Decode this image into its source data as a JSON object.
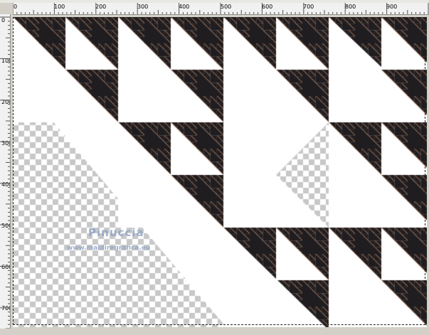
{
  "ruler": {
    "top_labels": [
      "0",
      "100",
      "200",
      "300",
      "400",
      "500",
      "600",
      "700",
      "800",
      "900"
    ],
    "left_labels": [
      "0",
      "100",
      "200",
      "300",
      "400",
      "500",
      "600",
      "700"
    ]
  },
  "watermark": {
    "name": "Pinuccia",
    "url": "www.maidiregrafica.eu"
  },
  "colors": {
    "pattern_dark": "#1f1d20",
    "pattern_brown": "#8b5a3c",
    "fill_white": "#ffffff",
    "checker_light": "#ffffff",
    "checker_dark": "#c8c8c8"
  }
}
